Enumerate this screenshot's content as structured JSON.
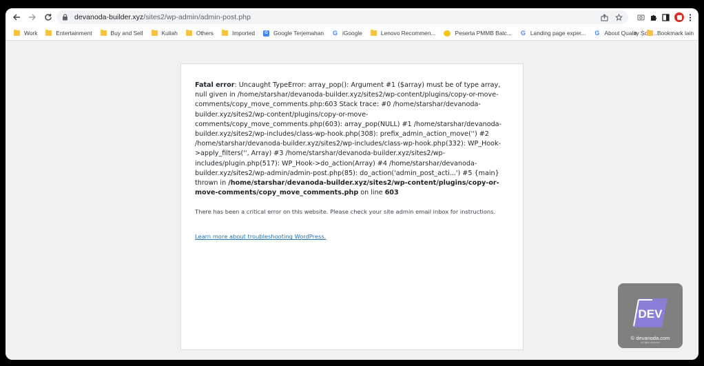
{
  "browser": {
    "url_host": "devanoda-builder.xyz",
    "url_path": "/sites2/wp-admin/admin-post.php",
    "icons": [
      "back-icon",
      "forward-icon",
      "reload-icon",
      "lock-icon",
      "share-icon",
      "star-icon",
      "screenshot-icon",
      "extensions-icon",
      "sidepanel-icon",
      "profile-icon",
      "menu-icon"
    ]
  },
  "bookmarks": {
    "items": [
      {
        "label": "Work",
        "icon": "folder"
      },
      {
        "label": "Entertainment",
        "icon": "folder"
      },
      {
        "label": "Buy and Sell",
        "icon": "folder"
      },
      {
        "label": "Kuliah",
        "icon": "folder"
      },
      {
        "label": "Others",
        "icon": "folder"
      },
      {
        "label": "Imported",
        "icon": "folder"
      },
      {
        "label": "Google Terjemahan",
        "icon": "google-translate"
      },
      {
        "label": "iGoogle",
        "icon": "google"
      },
      {
        "label": "Lenovo Recommen...",
        "icon": "folder"
      },
      {
        "label": "Peserta PMMB Batc...",
        "icon": "pmmb"
      },
      {
        "label": "Landing page exper...",
        "icon": "google"
      },
      {
        "label": "About Quality Scor...",
        "icon": "google"
      }
    ],
    "more": "»",
    "other_label": "Bookmark lain"
  },
  "page": {
    "error_label": "Fatal error",
    "error_text": ": Uncaught TypeError: array_pop(): Argument #1 ($array) must be of type array, null given in /home/starshar/devanoda-builder.xyz/sites2/wp-content/plugins/copy-or-move-comments/copy_move_comments.php:603 Stack trace: #0 /home/starshar/devanoda-builder.xyz/sites2/wp-content/plugins/copy-or-move-comments/copy_move_comments.php(603): array_pop(NULL) #1 /home/starshar/devanoda-builder.xyz/sites2/wp-includes/class-wp-hook.php(308): prefix_admin_action_move('') #2 /home/starshar/devanoda-builder.xyz/sites2/wp-includes/class-wp-hook.php(332): WP_Hook->apply_filters('', Array) #3 /home/starshar/devanoda-builder.xyz/sites2/wp-includes/plugin.php(517): WP_Hook->do_action(Array) #4 /home/starshar/devanoda-builder.xyz/sites2/wp-admin/admin-post.php(85): do_action('admin_post_acti...') #5 {main} thrown in ",
    "error_file": "/home/starshar/devanoda-builder.xyz/sites2/wp-content/plugins/copy-or-move-comments/copy_move_comments.php",
    "on_line_text": " on line ",
    "line_number": "603",
    "notice": "There has been a critical error on this website. Please check your site admin email inbox for instructions.",
    "learn_link": "Learn more about troubleshooting WordPress."
  },
  "watermark": {
    "logo_text": "DEV",
    "text": "© devanoda.com",
    "subtext": "all rights reserved"
  },
  "colors": {
    "link": "#2271b1",
    "logo_accent": "#8a7fd6",
    "profile": "#d93025"
  }
}
